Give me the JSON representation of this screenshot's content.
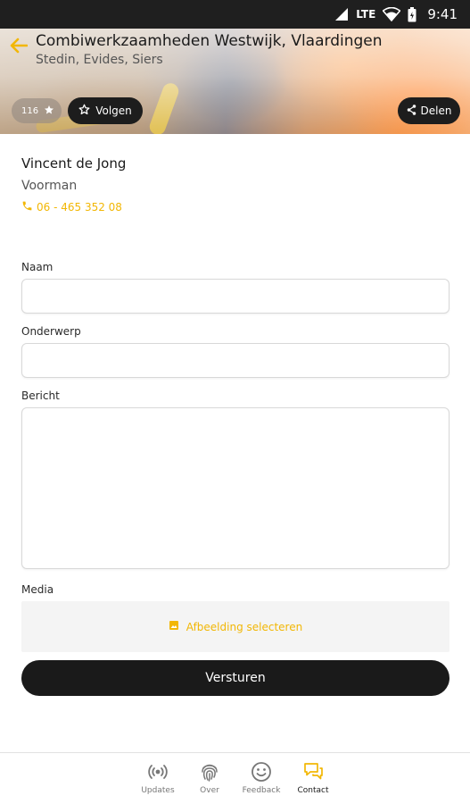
{
  "status_bar": {
    "network": "LTE",
    "time": "9:41"
  },
  "header": {
    "title": "Combiwerkzaamheden Westwijk, Vlaardingen",
    "subtitle": "Stedin, Evides, Siers",
    "follower_count": "116",
    "follow_label": "Volgen",
    "share_label": "Delen"
  },
  "contact": {
    "name": "Vincent de Jong",
    "role": "Voorman",
    "phone": "06 - 465 352 08"
  },
  "form": {
    "name_label": "Naam",
    "name_value": "",
    "subject_label": "Onderwerp",
    "subject_value": "",
    "message_label": "Bericht",
    "message_value": "",
    "media_label": "Media",
    "select_image_label": "Afbeelding selecteren",
    "submit_label": "Versturen"
  },
  "bottom_nav": {
    "items": [
      {
        "label": "Updates",
        "icon": "broadcast-icon",
        "active": false
      },
      {
        "label": "Over",
        "icon": "fingerprint-icon",
        "active": false
      },
      {
        "label": "Feedback",
        "icon": "smiley-icon",
        "active": false
      },
      {
        "label": "Contact",
        "icon": "chat-icon",
        "active": true
      }
    ]
  },
  "colors": {
    "accent": "#f2b705",
    "dark": "#1a1a1a",
    "orange_hero": "#ef8d3e"
  }
}
